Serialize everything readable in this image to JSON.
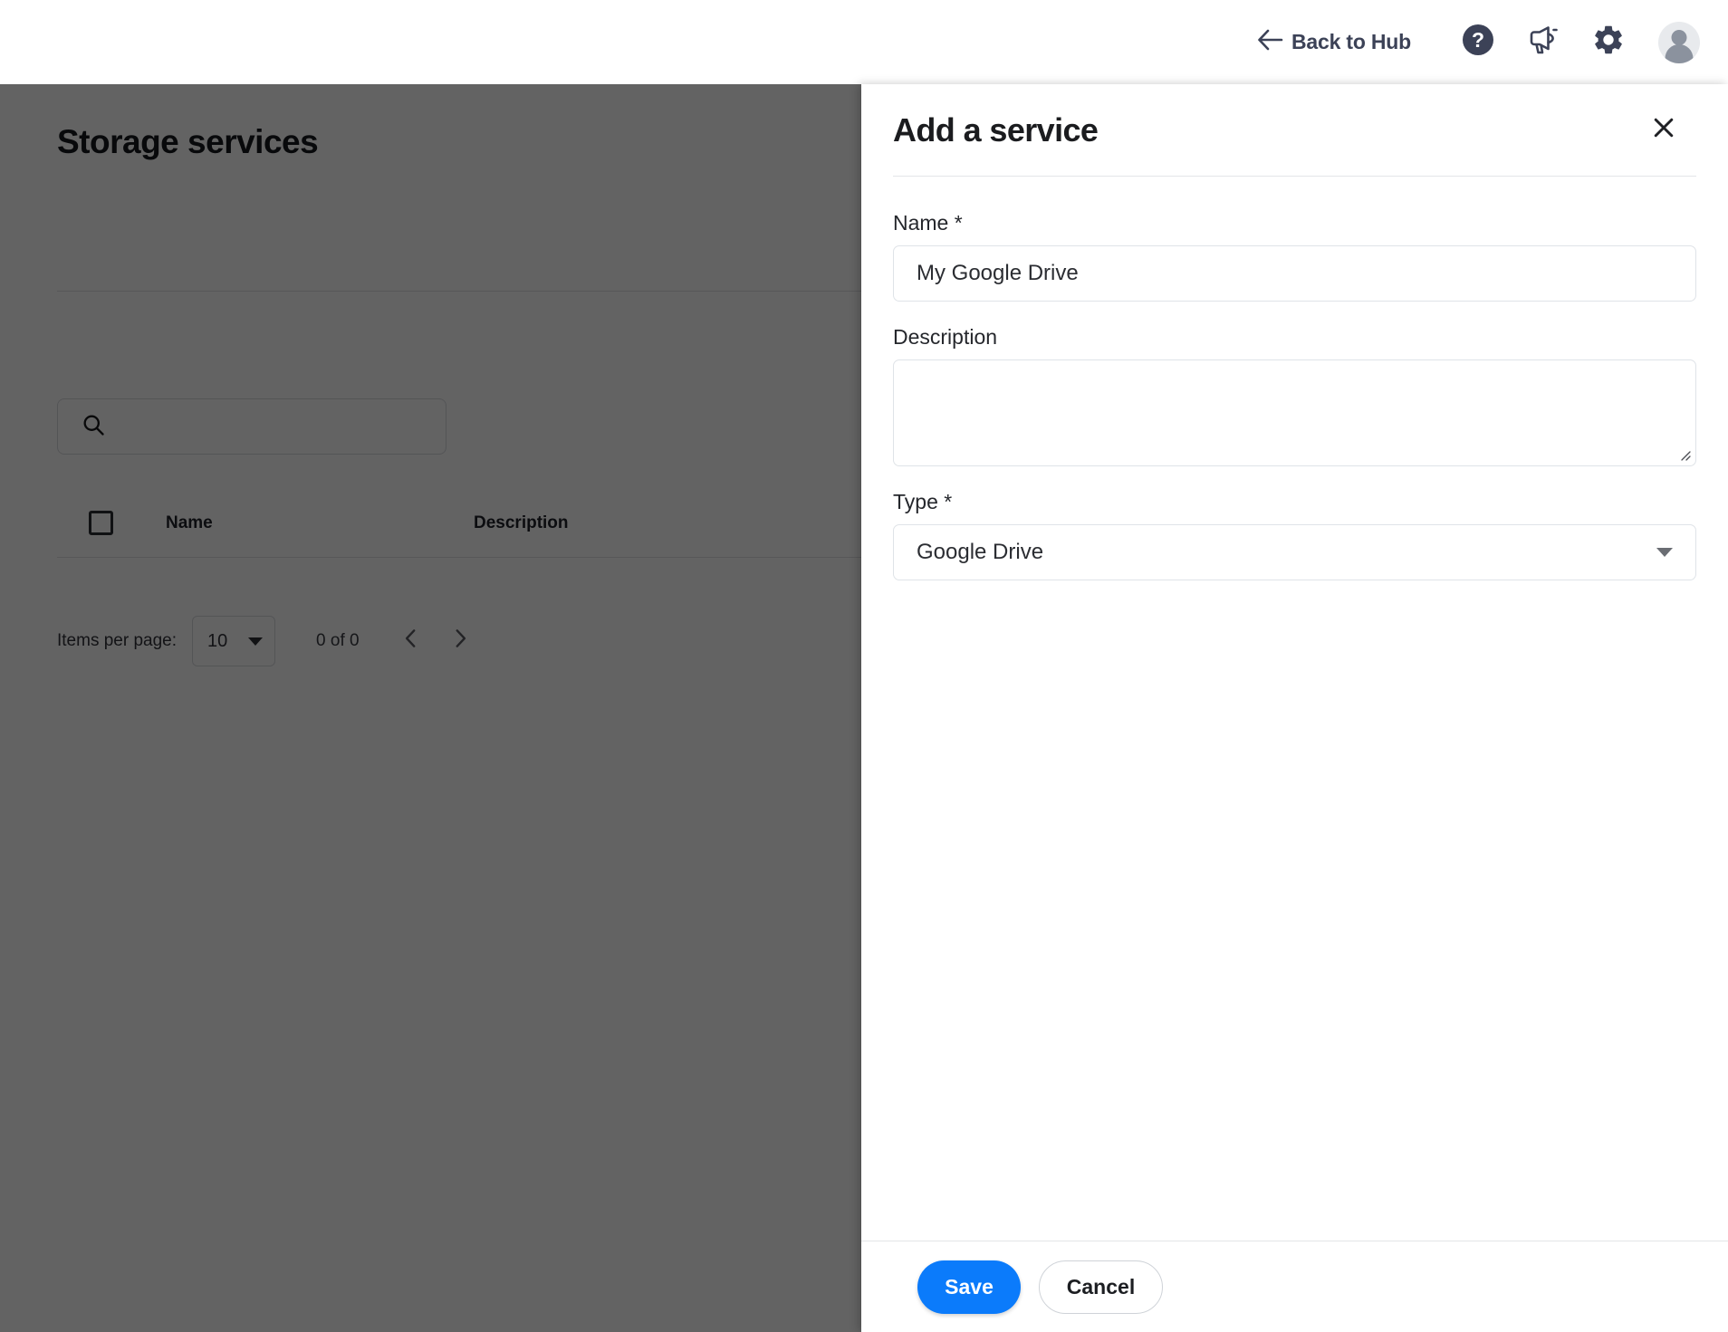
{
  "topbar": {
    "back_label": "Back to Hub",
    "back_arrow_icon": "arrow-left-icon",
    "help_icon": "help-circle-icon",
    "announcements_icon": "megaphone-icon",
    "settings_icon": "gear-icon",
    "avatar_icon": "user-avatar-icon",
    "text_color": "#3c4257"
  },
  "page": {
    "title": "Storage services",
    "search": {
      "value": "",
      "placeholder": "",
      "icon": "search-icon"
    },
    "table": {
      "select_all_checkbox": "unchecked",
      "columns": [
        "Name",
        "Description"
      ],
      "rows": []
    },
    "paginator": {
      "items_per_page_label": "Items per page:",
      "items_per_page_value": "10",
      "range_label": "0 of 0",
      "prev_icon": "chevron-left-icon",
      "next_icon": "chevron-right-icon"
    }
  },
  "panel": {
    "title": "Add a service",
    "close_icon": "close-icon",
    "fields": {
      "name": {
        "label": "Name *",
        "value": "My Google Drive",
        "placeholder": ""
      },
      "description": {
        "label": "Description",
        "value": "",
        "placeholder": "",
        "resize_handle_icon": "resize-grip-icon"
      },
      "type": {
        "label": "Type *",
        "value": "Google Drive",
        "caret_icon": "triangle-down-icon"
      }
    },
    "footer": {
      "save_label": "Save",
      "cancel_label": "Cancel",
      "save_color": "#0b7bfb"
    }
  },
  "overlay": {
    "scrim_color": "rgba(0,0,0,0.612)"
  }
}
